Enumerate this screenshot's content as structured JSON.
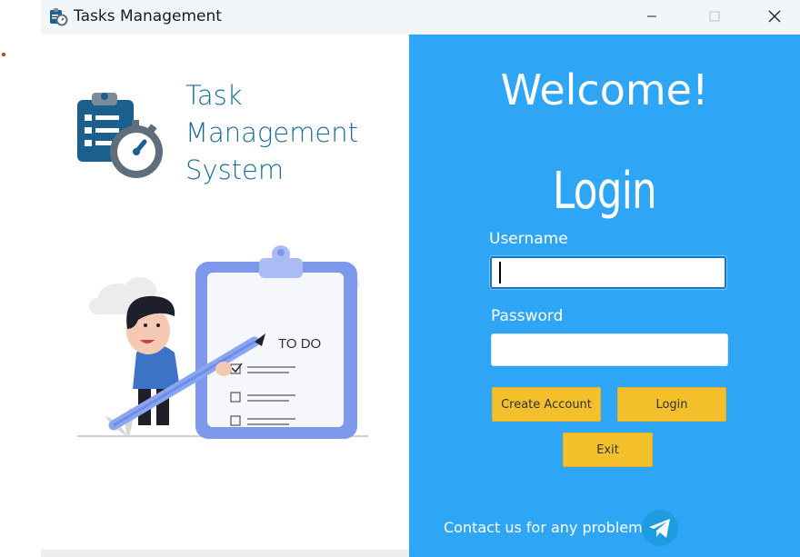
{
  "window": {
    "title": "Tasks Management",
    "controls": [
      "minimize",
      "maximize",
      "close"
    ]
  },
  "left": {
    "brand_lines": [
      "Task",
      "Management",
      "System"
    ],
    "illustration_text": "TO DO"
  },
  "right": {
    "welcome": "Welcome!",
    "login_title": "Login",
    "username_label": "Username",
    "username_value": "",
    "password_label": "Password",
    "password_value": "",
    "create_account_label": "Create Account",
    "login_label": "Login",
    "exit_label": "Exit",
    "contact_text": "Contact us for any problem"
  },
  "colors": {
    "panel_blue": "#2ea6f5",
    "button_yellow": "#f3c02c",
    "brand_text": "#1a6f96"
  },
  "icons": [
    "app-icon",
    "minimize-icon",
    "maximize-icon",
    "close-icon",
    "task-logo-icon",
    "telegram-icon"
  ]
}
